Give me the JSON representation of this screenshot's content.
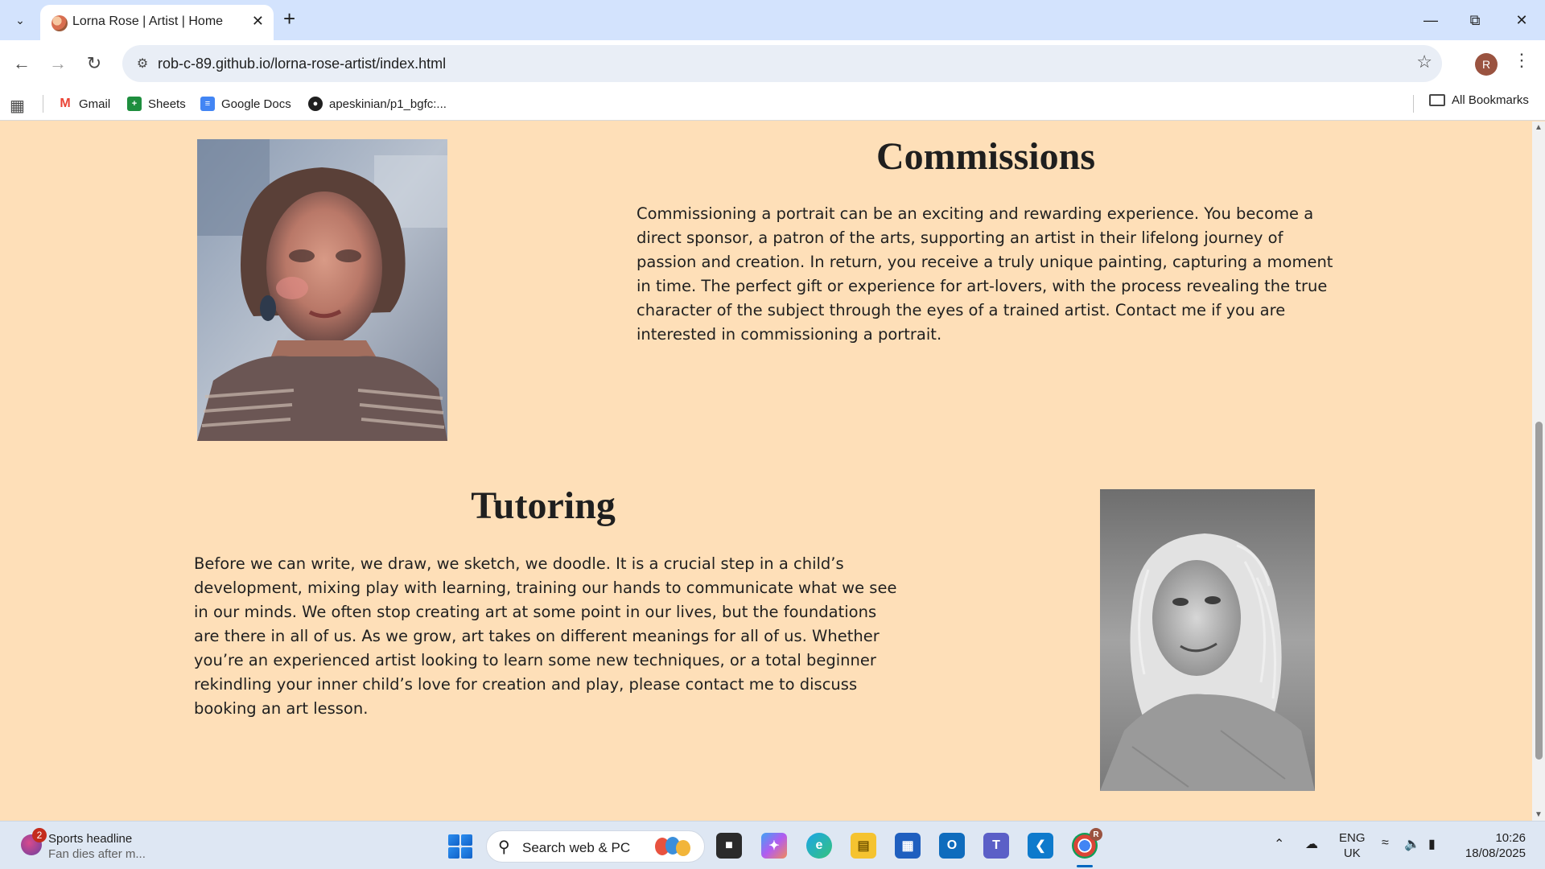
{
  "browser": {
    "tab_title": "Lorna Rose | Artist | Home",
    "url": "rob-c-89.github.io/lorna-rose-artist/index.html",
    "profile_initial": "R",
    "bookmarks": [
      {
        "label": "Gmail",
        "icon": "gmail-icon"
      },
      {
        "label": "Sheets",
        "icon": "sheets-icon"
      },
      {
        "label": "Google Docs",
        "icon": "docs-icon"
      },
      {
        "label": "apeskinian/p1_bgfc:...",
        "icon": "github-icon"
      }
    ],
    "all_bookmarks_label": "All Bookmarks"
  },
  "page": {
    "commissions": {
      "title": "Commissions",
      "body": "Commissioning a portrait can be an exciting and rewarding experience. You become a direct sponsor, a patron of the arts, supporting an artist in their lifelong journey of passion and creation. In return, you receive a truly unique painting, capturing a moment in time. The perfect gift or experience for art-lovers, with the process revealing the true character of the subject through the eyes of a trained artist. Contact me if you are interested in commissioning a portrait."
    },
    "tutoring": {
      "title": "Tutoring",
      "body": "Before we can write, we draw, we sketch, we doodle. It is a crucial step in a child’s development, mixing play with learning, training our hands to communicate what we see in our minds. We often stop creating art at some point in our lives, but the foundations are there in all of us. As we grow, art takes on different meanings for all of us. Whether you’re an experienced artist looking to learn some new techniques, or a total beginner rekindling your inner child’s love for creation and play, please contact me to discuss booking an art lesson."
    },
    "background_color": "#FEDFB8"
  },
  "taskbar": {
    "news_badge": "2",
    "news_title": "Sports headline",
    "news_subtitle": "Fan dies after m...",
    "search_placeholder": "Search web & PC",
    "language": "ENG",
    "region": "UK",
    "time": "10:26",
    "date": "18/08/2025",
    "chrome_badge": "R"
  }
}
